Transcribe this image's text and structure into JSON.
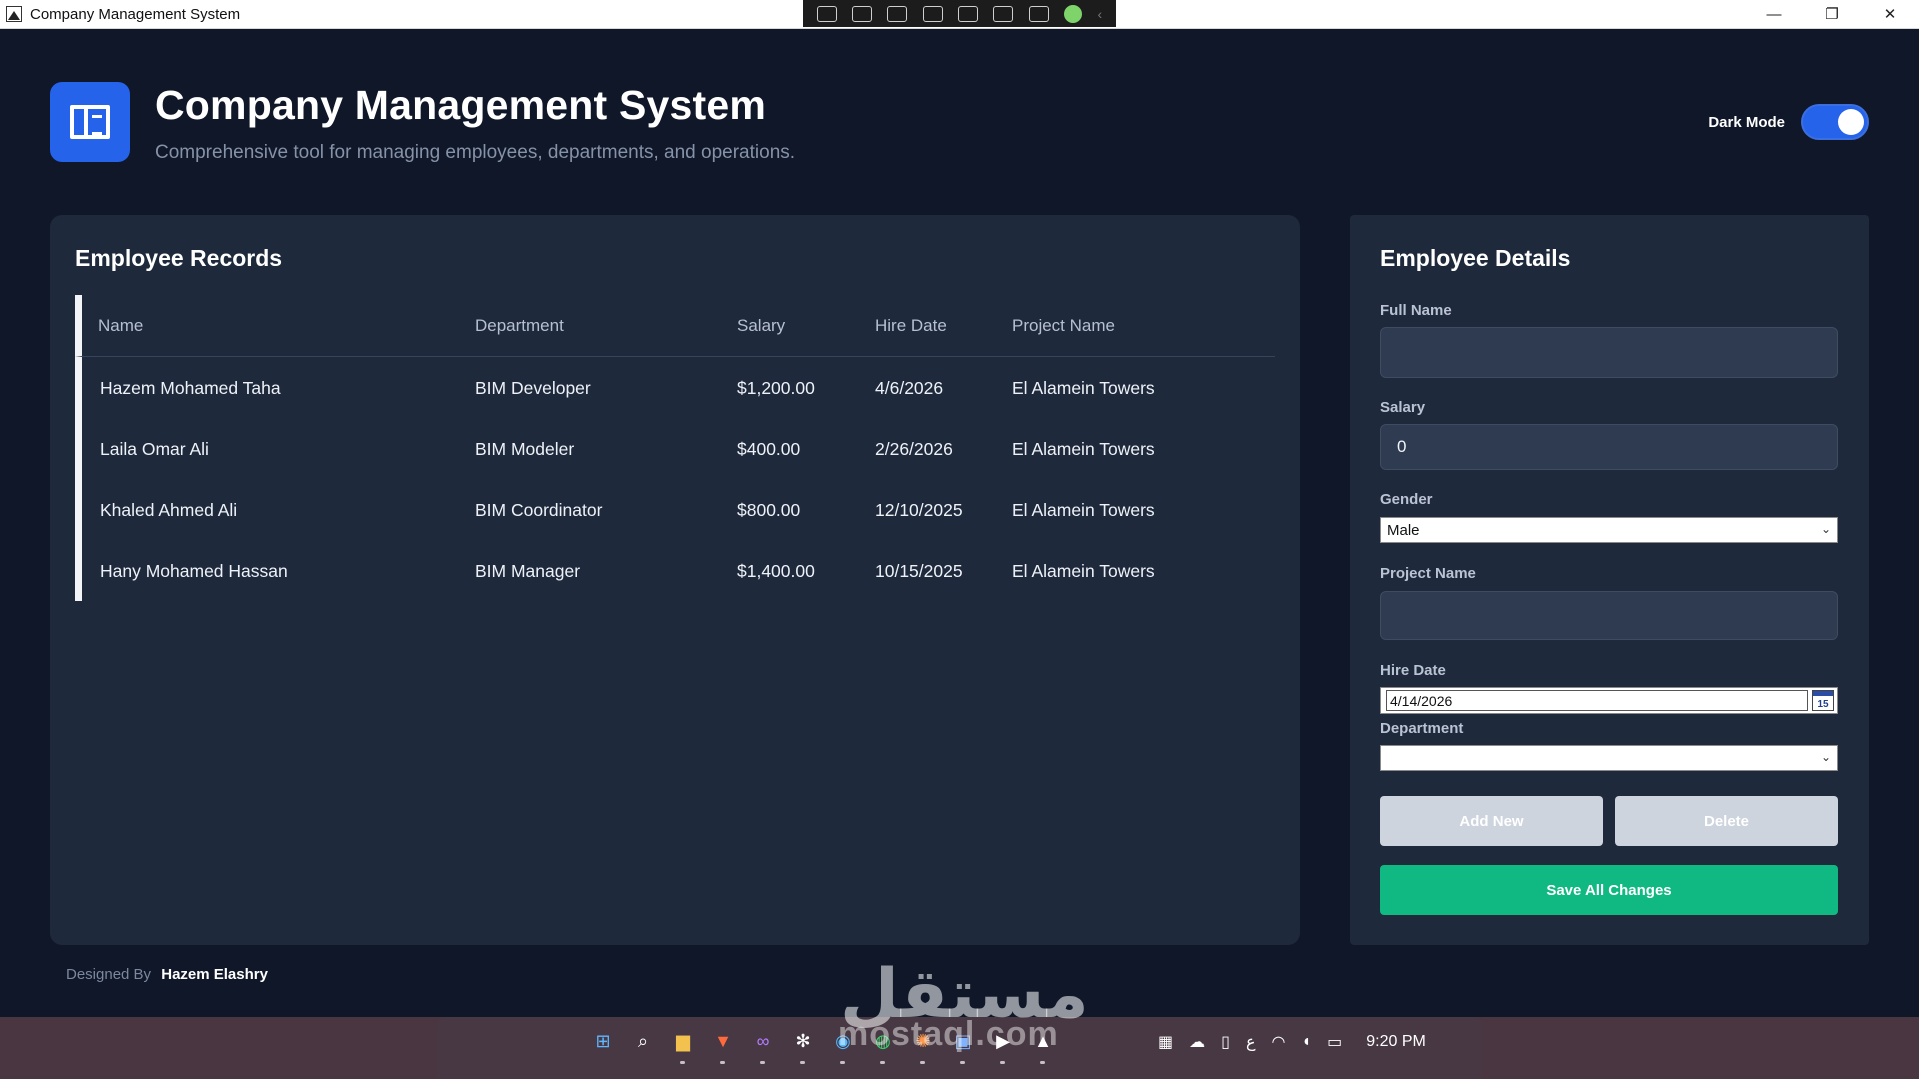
{
  "window": {
    "title": "Company Management System"
  },
  "header": {
    "title": "Company Management System",
    "subtitle": "Comprehensive tool for managing employees, departments, and operations.",
    "dark_mode_label": "Dark Mode",
    "dark_mode_on": true
  },
  "records": {
    "title": "Employee Records",
    "columns": [
      "Name",
      "Department",
      "Salary",
      "Hire Date",
      "Project Name"
    ],
    "rows": [
      [
        "Hazem Mohamed Taha",
        "BIM Developer",
        "$1,200.00",
        "4/6/2026",
        "El Alamein Towers"
      ],
      [
        "Laila Omar Ali",
        "BIM Modeler",
        "$400.00",
        "2/26/2026",
        "El Alamein Towers"
      ],
      [
        "Khaled Ahmed Ali",
        "BIM Coordinator",
        "$800.00",
        "12/10/2025",
        "El Alamein Towers"
      ],
      [
        "Hany Mohamed Hassan",
        "BIM Manager",
        "$1,400.00",
        "10/15/2025",
        "El Alamein Towers"
      ]
    ]
  },
  "details": {
    "title": "Employee Details",
    "full_name_label": "Full Name",
    "full_name_value": "",
    "salary_label": "Salary",
    "salary_value": "0",
    "gender_label": "Gender",
    "gender_value": "Male",
    "project_label": "Project Name",
    "project_value": "",
    "hire_date_label": "Hire Date",
    "hire_date_value": "4/14/2026",
    "calendar_day": "15",
    "department_label": "Department",
    "department_value": "",
    "add_label": "Add New",
    "delete_label": "Delete",
    "save_label": "Save All Changes"
  },
  "footer": {
    "designed_by_label": "Designed By",
    "designer": "Hazem Elashry"
  },
  "watermark": {
    "arabic": "مستقل",
    "latin": "mostaql.com"
  },
  "taskbar": {
    "clock": "9:20 PM",
    "ime": "ع"
  },
  "colors": {
    "background": "#0f1729",
    "panel": "#1e293b",
    "accent": "#2563eb",
    "save": "#10b981"
  }
}
